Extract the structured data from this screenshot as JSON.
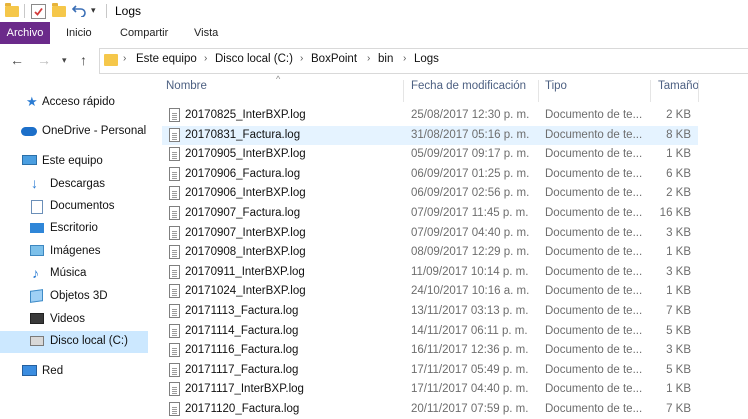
{
  "window": {
    "title": "Logs"
  },
  "ribbon": {
    "tabs": [
      "Archivo",
      "Inicio",
      "Compartir",
      "Vista"
    ]
  },
  "address": {
    "crumbs": [
      "Este equipo",
      "Disco local (C:)",
      "BoxPoint",
      "bin",
      "Logs"
    ]
  },
  "nav": {
    "items": [
      {
        "label": "Acceso rápido",
        "icon": "star-icon"
      },
      {
        "label": "OneDrive - Personal",
        "icon": "cloud-icon"
      },
      {
        "label": "Este equipo",
        "icon": "computer-icon"
      },
      {
        "label": "Descargas",
        "icon": "download-icon"
      },
      {
        "label": "Documentos",
        "icon": "documents-icon"
      },
      {
        "label": "Escritorio",
        "icon": "desktop-icon"
      },
      {
        "label": "Imágenes",
        "icon": "pictures-icon"
      },
      {
        "label": "Música",
        "icon": "music-icon"
      },
      {
        "label": "Objetos 3D",
        "icon": "3d-objects-icon"
      },
      {
        "label": "Videos",
        "icon": "videos-icon"
      },
      {
        "label": "Disco local (C:)",
        "icon": "drive-icon"
      },
      {
        "label": "Red",
        "icon": "network-icon"
      }
    ]
  },
  "columns": {
    "name": "Nombre",
    "date": "Fecha de modificación",
    "type": "Tipo",
    "size": "Tamaño"
  },
  "files": [
    {
      "name": "20170825_InterBXP.log",
      "date": "25/08/2017 12:30 p. m.",
      "type": "Documento de te...",
      "size": "2 KB"
    },
    {
      "name": "20170831_Factura.log",
      "date": "31/08/2017 05:16 p. m.",
      "type": "Documento de te...",
      "size": "8 KB"
    },
    {
      "name": "20170905_InterBXP.log",
      "date": "05/09/2017 09:17 p. m.",
      "type": "Documento de te...",
      "size": "1 KB"
    },
    {
      "name": "20170906_Factura.log",
      "date": "06/09/2017 01:25 p. m.",
      "type": "Documento de te...",
      "size": "6 KB"
    },
    {
      "name": "20170906_InterBXP.log",
      "date": "06/09/2017 02:56 p. m.",
      "type": "Documento de te...",
      "size": "2 KB"
    },
    {
      "name": "20170907_Factura.log",
      "date": "07/09/2017 11:45 p. m.",
      "type": "Documento de te...",
      "size": "16 KB"
    },
    {
      "name": "20170907_InterBXP.log",
      "date": "07/09/2017 04:40 p. m.",
      "type": "Documento de te...",
      "size": "3 KB"
    },
    {
      "name": "20170908_InterBXP.log",
      "date": "08/09/2017 12:29 p. m.",
      "type": "Documento de te...",
      "size": "1 KB"
    },
    {
      "name": "20170911_InterBXP.log",
      "date": "11/09/2017 10:14 p. m.",
      "type": "Documento de te...",
      "size": "3 KB"
    },
    {
      "name": "20171024_InterBXP.log",
      "date": "24/10/2017 10:16 a. m.",
      "type": "Documento de te...",
      "size": "1 KB"
    },
    {
      "name": "20171113_Factura.log",
      "date": "13/11/2017 03:13 p. m.",
      "type": "Documento de te...",
      "size": "7 KB"
    },
    {
      "name": "20171114_Factura.log",
      "date": "14/11/2017 06:11 p. m.",
      "type": "Documento de te...",
      "size": "5 KB"
    },
    {
      "name": "20171116_Factura.log",
      "date": "16/11/2017 12:36 p. m.",
      "type": "Documento de te...",
      "size": "3 KB"
    },
    {
      "name": "20171117_Factura.log",
      "date": "17/11/2017 05:49 p. m.",
      "type": "Documento de te...",
      "size": "5 KB"
    },
    {
      "name": "20171117_InterBXP.log",
      "date": "17/11/2017 04:40 p. m.",
      "type": "Documento de te...",
      "size": "1 KB"
    },
    {
      "name": "20171120_Factura.log",
      "date": "20/11/2017 07:59 p. m.",
      "type": "Documento de te...",
      "size": "7 KB"
    }
  ],
  "colors": {
    "accent_file_tab": "#6b2a8a",
    "selection": "#cce8ff",
    "hover_row": "#e5f3ff",
    "folder": "#f5c74a"
  }
}
